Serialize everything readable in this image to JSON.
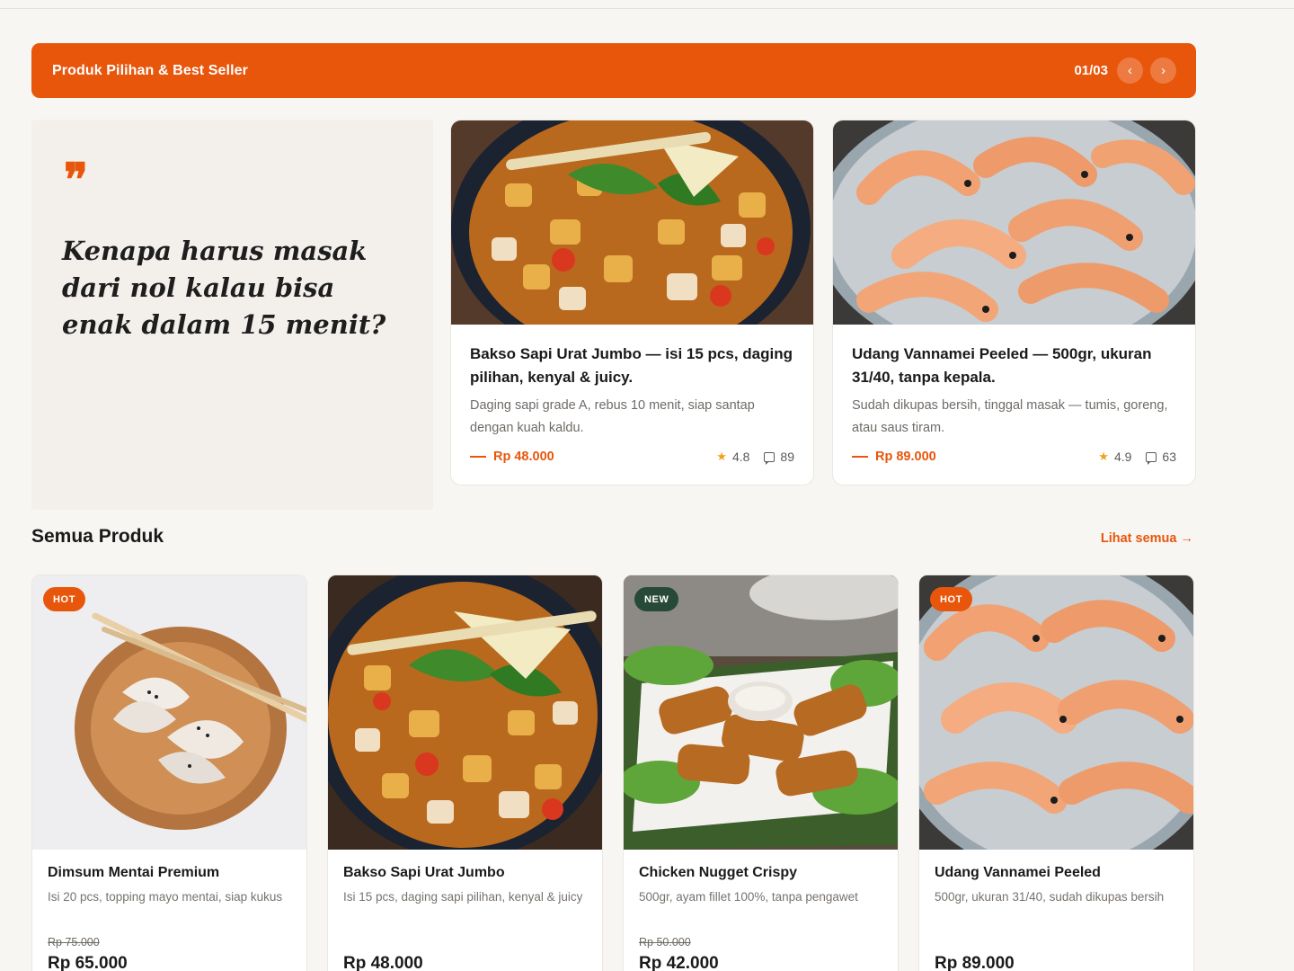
{
  "banner": {
    "title": "Produk Pilihan & Best Seller",
    "counter": "01/03",
    "prev_icon": "‹",
    "next_icon": "›",
    "accent_color": "#e8560c"
  },
  "quote": {
    "mark": "❞",
    "text": "Kenapa harus masak dari nol kalau bisa enak dalam 15 menit?"
  },
  "featured": [
    {
      "title": "Bakso Sapi Urat Jumbo — isi 15 pcs, daging pilihan, kenyal & juicy.",
      "desc": "Daging sapi grade A, rebus 10 menit, siap santap dengan kuah kaldu.",
      "price": "Rp 48.000",
      "rating": "4.8",
      "reviews": "89"
    },
    {
      "title": "Udang Vannamei Peeled — 500gr, ukuran 31/40, tanpa kepala.",
      "desc": "Sudah dikupas bersih, tinggal masak — tumis, goreng, atau saus tiram.",
      "price": "Rp 89.000",
      "rating": "4.9",
      "reviews": "63"
    }
  ],
  "section": {
    "title": "Semua Produk",
    "see_all": "Lihat semua →"
  },
  "products": [
    {
      "badge": "HOT",
      "name": "Dimsum Mentai Premium",
      "desc": "Isi 20 pcs, topping mayo mentai, siap kukus",
      "old_price": "Rp 75.000",
      "price": "Rp 65.000"
    },
    {
      "badge": "",
      "name": "Bakso Sapi Urat Jumbo",
      "desc": "Isi 15 pcs, daging sapi pilihan, kenyal & juicy",
      "old_price": "",
      "price": "Rp 48.000"
    },
    {
      "badge": "NEW",
      "name": "Chicken Nugget Crispy",
      "desc": "500gr, ayam fillet 100%, tanpa pengawet",
      "old_price": "Rp 50.000",
      "price": "Rp 42.000"
    },
    {
      "badge": "HOT",
      "name": "Udang Vannamei Peeled",
      "desc": "500gr, ukuran 31/40, sudah dikupas bersih",
      "old_price": "",
      "price": "Rp 89.000"
    }
  ]
}
